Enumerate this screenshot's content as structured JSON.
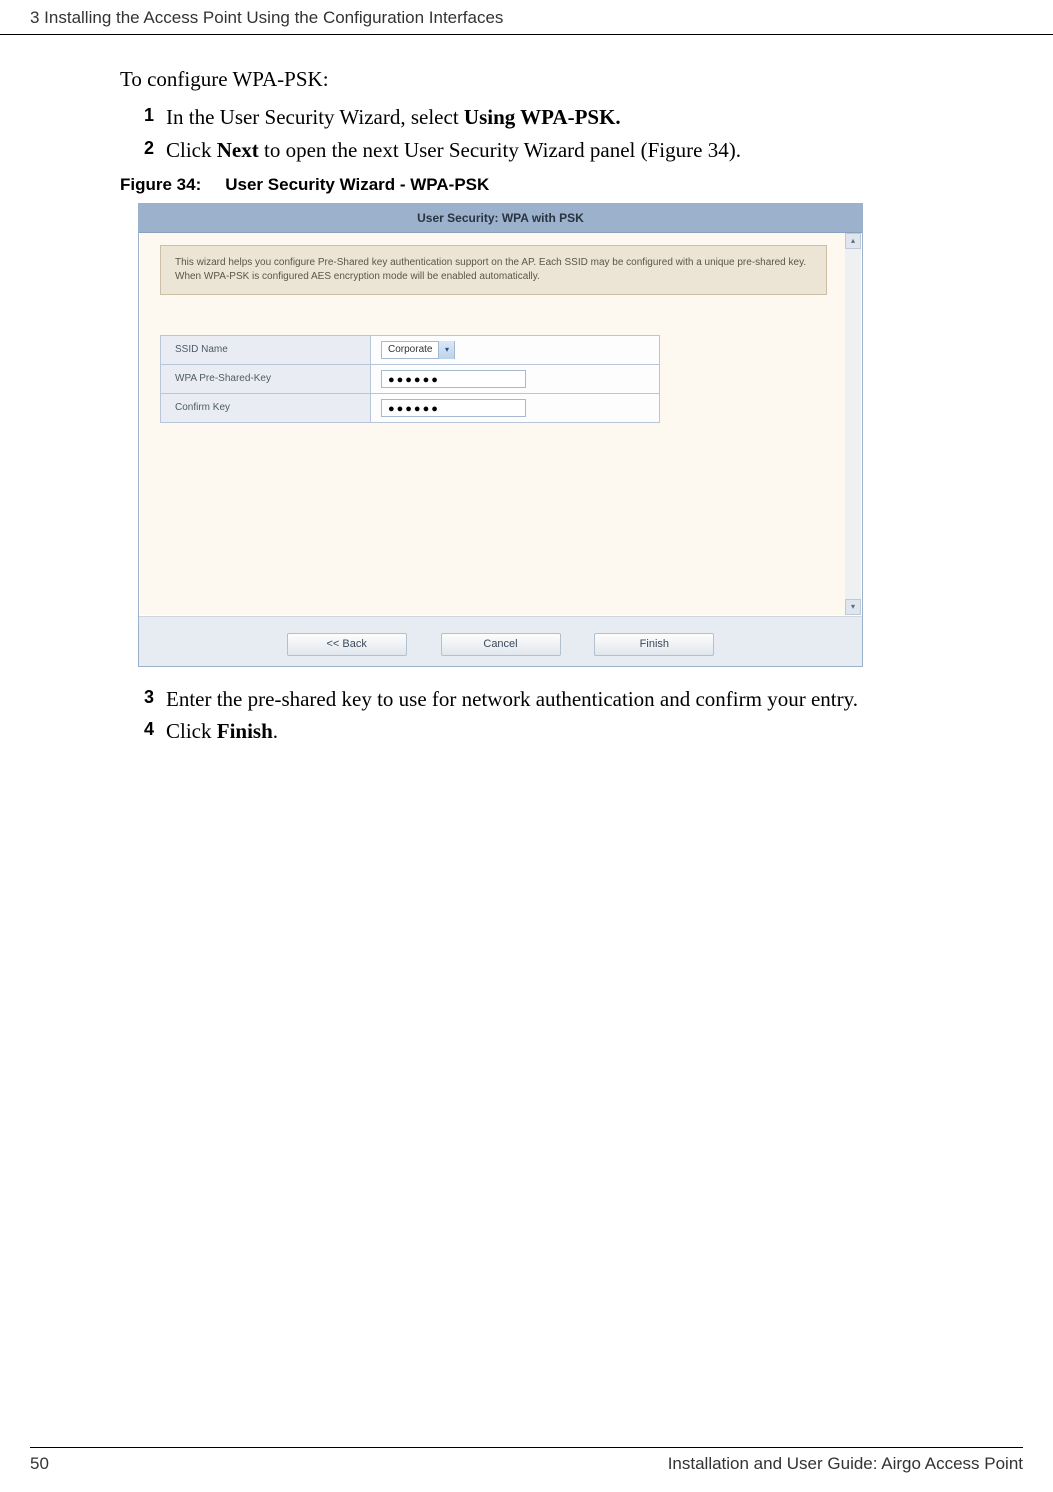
{
  "header": {
    "chapter": "3  Installing the Access Point Using the Configuration Interfaces"
  },
  "intro": "To configure WPA-PSK:",
  "steps_top": [
    {
      "n": "1",
      "pre": "In the User Security Wizard, select ",
      "bold": "Using WPA-PSK.",
      "post": ""
    },
    {
      "n": "2",
      "pre": "Click ",
      "bold": "Next",
      "post": " to open the next User Security Wizard panel (Figure 34)."
    }
  ],
  "figure": {
    "label": "Figure 34:",
    "title": "User Security Wizard - WPA-PSK"
  },
  "wizard": {
    "title": "User Security: WPA with PSK",
    "info": "This wizard helps you configure Pre-Shared key authentication support on the AP. Each SSID may be configured with a unique pre-shared key. When WPA-PSK is configured AES encryption mode will be enabled automatically.",
    "rows": {
      "ssid_label": "SSID Name",
      "ssid_value": "Corporate",
      "psk_label": "WPA Pre-Shared-Key",
      "psk_value": "●●●●●●",
      "confirm_label": "Confirm Key",
      "confirm_value": "●●●●●●"
    },
    "buttons": {
      "back": "<< Back",
      "cancel": "Cancel",
      "finish": "Finish"
    }
  },
  "steps_bottom": [
    {
      "n": "3",
      "pre": "Enter the pre-shared key to use for network authentication and confirm your entry.",
      "bold": "",
      "post": ""
    },
    {
      "n": "4",
      "pre": "Click ",
      "bold": "Finish",
      "post": "."
    }
  ],
  "footer": {
    "page": "50",
    "title": "Installation and User Guide: Airgo Access Point"
  }
}
